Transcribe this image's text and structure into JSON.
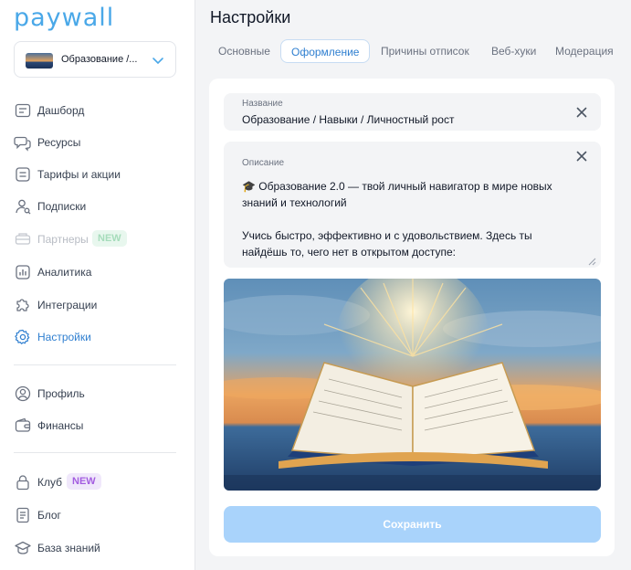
{
  "app": {
    "logo": "paywall"
  },
  "project": {
    "name": "Образование /..."
  },
  "nav": {
    "main": [
      {
        "label": "Дашборд"
      },
      {
        "label": "Ресурсы"
      },
      {
        "label": "Тарифы и акции"
      },
      {
        "label": "Подписки"
      },
      {
        "label": "Партнеры",
        "badge": "NEW"
      },
      {
        "label": "Аналитика"
      },
      {
        "label": "Интеграции"
      },
      {
        "label": "Настройки"
      }
    ],
    "account": [
      {
        "label": "Профиль"
      },
      {
        "label": "Финансы"
      }
    ],
    "extra": [
      {
        "label": "Клуб",
        "badge": "NEW"
      },
      {
        "label": "Блог"
      },
      {
        "label": "База знаний"
      }
    ]
  },
  "page": {
    "title": "Настройки",
    "tabs": [
      {
        "label": "Основные"
      },
      {
        "label": "Оформление"
      },
      {
        "label": "Причины отписок"
      },
      {
        "label": "Веб-хуки"
      },
      {
        "label": "Модерация"
      }
    ]
  },
  "form": {
    "name_label": "Название",
    "name_value": "Образование / Навыки / Личностный рост",
    "desc_label": "Описание",
    "desc_value": "🎓 Образование 2.0 — твой личный навигатор в мире новых знаний и технологий\n\nУчись быстро, эффективно и с удовольствием. Здесь ты найдёшь то, чего нет в открытом доступе:",
    "save_label": "Сохранить"
  },
  "colors": {
    "accent": "#2f7fd0",
    "logo": "#4aa8e8",
    "save_disabled": "#a9d3fb",
    "badge_purple": "#a35de0"
  }
}
